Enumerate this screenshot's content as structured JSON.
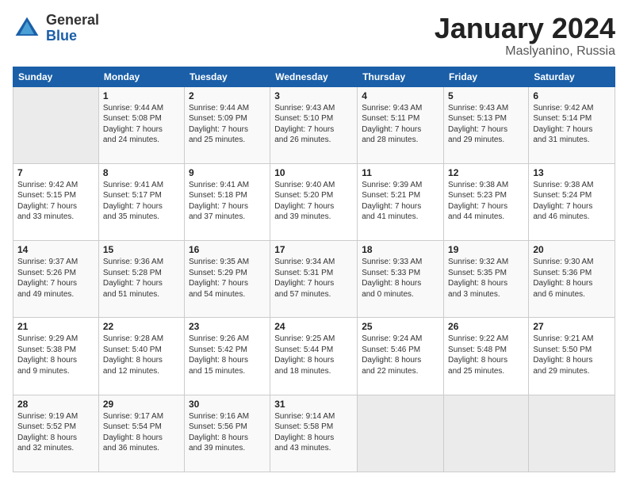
{
  "header": {
    "logo_general": "General",
    "logo_blue": "Blue",
    "month_title": "January 2024",
    "location": "Maslyanino, Russia"
  },
  "days_of_week": [
    "Sunday",
    "Monday",
    "Tuesday",
    "Wednesday",
    "Thursday",
    "Friday",
    "Saturday"
  ],
  "weeks": [
    [
      {
        "day": "",
        "info": ""
      },
      {
        "day": "1",
        "info": "Sunrise: 9:44 AM\nSunset: 5:08 PM\nDaylight: 7 hours\nand 24 minutes."
      },
      {
        "day": "2",
        "info": "Sunrise: 9:44 AM\nSunset: 5:09 PM\nDaylight: 7 hours\nand 25 minutes."
      },
      {
        "day": "3",
        "info": "Sunrise: 9:43 AM\nSunset: 5:10 PM\nDaylight: 7 hours\nand 26 minutes."
      },
      {
        "day": "4",
        "info": "Sunrise: 9:43 AM\nSunset: 5:11 PM\nDaylight: 7 hours\nand 28 minutes."
      },
      {
        "day": "5",
        "info": "Sunrise: 9:43 AM\nSunset: 5:13 PM\nDaylight: 7 hours\nand 29 minutes."
      },
      {
        "day": "6",
        "info": "Sunrise: 9:42 AM\nSunset: 5:14 PM\nDaylight: 7 hours\nand 31 minutes."
      }
    ],
    [
      {
        "day": "7",
        "info": "Sunrise: 9:42 AM\nSunset: 5:15 PM\nDaylight: 7 hours\nand 33 minutes."
      },
      {
        "day": "8",
        "info": "Sunrise: 9:41 AM\nSunset: 5:17 PM\nDaylight: 7 hours\nand 35 minutes."
      },
      {
        "day": "9",
        "info": "Sunrise: 9:41 AM\nSunset: 5:18 PM\nDaylight: 7 hours\nand 37 minutes."
      },
      {
        "day": "10",
        "info": "Sunrise: 9:40 AM\nSunset: 5:20 PM\nDaylight: 7 hours\nand 39 minutes."
      },
      {
        "day": "11",
        "info": "Sunrise: 9:39 AM\nSunset: 5:21 PM\nDaylight: 7 hours\nand 41 minutes."
      },
      {
        "day": "12",
        "info": "Sunrise: 9:38 AM\nSunset: 5:23 PM\nDaylight: 7 hours\nand 44 minutes."
      },
      {
        "day": "13",
        "info": "Sunrise: 9:38 AM\nSunset: 5:24 PM\nDaylight: 7 hours\nand 46 minutes."
      }
    ],
    [
      {
        "day": "14",
        "info": "Sunrise: 9:37 AM\nSunset: 5:26 PM\nDaylight: 7 hours\nand 49 minutes."
      },
      {
        "day": "15",
        "info": "Sunrise: 9:36 AM\nSunset: 5:28 PM\nDaylight: 7 hours\nand 51 minutes."
      },
      {
        "day": "16",
        "info": "Sunrise: 9:35 AM\nSunset: 5:29 PM\nDaylight: 7 hours\nand 54 minutes."
      },
      {
        "day": "17",
        "info": "Sunrise: 9:34 AM\nSunset: 5:31 PM\nDaylight: 7 hours\nand 57 minutes."
      },
      {
        "day": "18",
        "info": "Sunrise: 9:33 AM\nSunset: 5:33 PM\nDaylight: 8 hours\nand 0 minutes."
      },
      {
        "day": "19",
        "info": "Sunrise: 9:32 AM\nSunset: 5:35 PM\nDaylight: 8 hours\nand 3 minutes."
      },
      {
        "day": "20",
        "info": "Sunrise: 9:30 AM\nSunset: 5:36 PM\nDaylight: 8 hours\nand 6 minutes."
      }
    ],
    [
      {
        "day": "21",
        "info": "Sunrise: 9:29 AM\nSunset: 5:38 PM\nDaylight: 8 hours\nand 9 minutes."
      },
      {
        "day": "22",
        "info": "Sunrise: 9:28 AM\nSunset: 5:40 PM\nDaylight: 8 hours\nand 12 minutes."
      },
      {
        "day": "23",
        "info": "Sunrise: 9:26 AM\nSunset: 5:42 PM\nDaylight: 8 hours\nand 15 minutes."
      },
      {
        "day": "24",
        "info": "Sunrise: 9:25 AM\nSunset: 5:44 PM\nDaylight: 8 hours\nand 18 minutes."
      },
      {
        "day": "25",
        "info": "Sunrise: 9:24 AM\nSunset: 5:46 PM\nDaylight: 8 hours\nand 22 minutes."
      },
      {
        "day": "26",
        "info": "Sunrise: 9:22 AM\nSunset: 5:48 PM\nDaylight: 8 hours\nand 25 minutes."
      },
      {
        "day": "27",
        "info": "Sunrise: 9:21 AM\nSunset: 5:50 PM\nDaylight: 8 hours\nand 29 minutes."
      }
    ],
    [
      {
        "day": "28",
        "info": "Sunrise: 9:19 AM\nSunset: 5:52 PM\nDaylight: 8 hours\nand 32 minutes."
      },
      {
        "day": "29",
        "info": "Sunrise: 9:17 AM\nSunset: 5:54 PM\nDaylight: 8 hours\nand 36 minutes."
      },
      {
        "day": "30",
        "info": "Sunrise: 9:16 AM\nSunset: 5:56 PM\nDaylight: 8 hours\nand 39 minutes."
      },
      {
        "day": "31",
        "info": "Sunrise: 9:14 AM\nSunset: 5:58 PM\nDaylight: 8 hours\nand 43 minutes."
      },
      {
        "day": "",
        "info": ""
      },
      {
        "day": "",
        "info": ""
      },
      {
        "day": "",
        "info": ""
      }
    ]
  ]
}
